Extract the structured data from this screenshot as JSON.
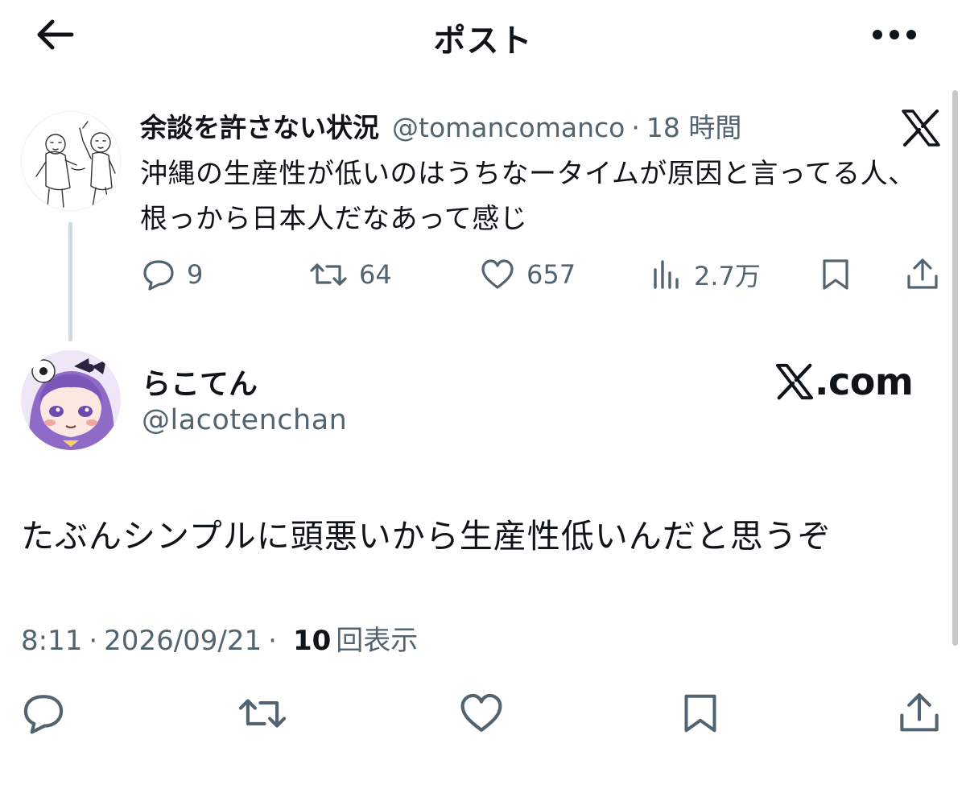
{
  "header": {
    "title": "ポスト",
    "back_icon": "arrow-left-icon",
    "more_icon": "more-horizontal-icon"
  },
  "quoted_post": {
    "author_name": "余談を許さない状況",
    "author_handle": "@tomancomanco",
    "separator": "·",
    "time": "18 時間",
    "text": "沖縄の生産性が低いのはうちなータイムが原因と言ってる人、根っから日本人だなあって感じ",
    "logo_icon": "x-logo-icon",
    "actions": {
      "replies": "9",
      "reposts": "64",
      "likes": "657",
      "views": "2.7万"
    }
  },
  "main_post": {
    "author_name": "らこてん",
    "author_handle": "@lacotenchan",
    "watermark": ".com",
    "text": "たぶんシンプルに頭悪いから生産性低いんだと思うぞ",
    "time": "8:11",
    "separator": "·",
    "date": "2026/09/21",
    "views_count": "10",
    "views_label": "回表示"
  },
  "colors": {
    "text": "#0f1419",
    "secondary": "#536471",
    "thread_line": "#cfd9de",
    "background": "#ffffff"
  }
}
